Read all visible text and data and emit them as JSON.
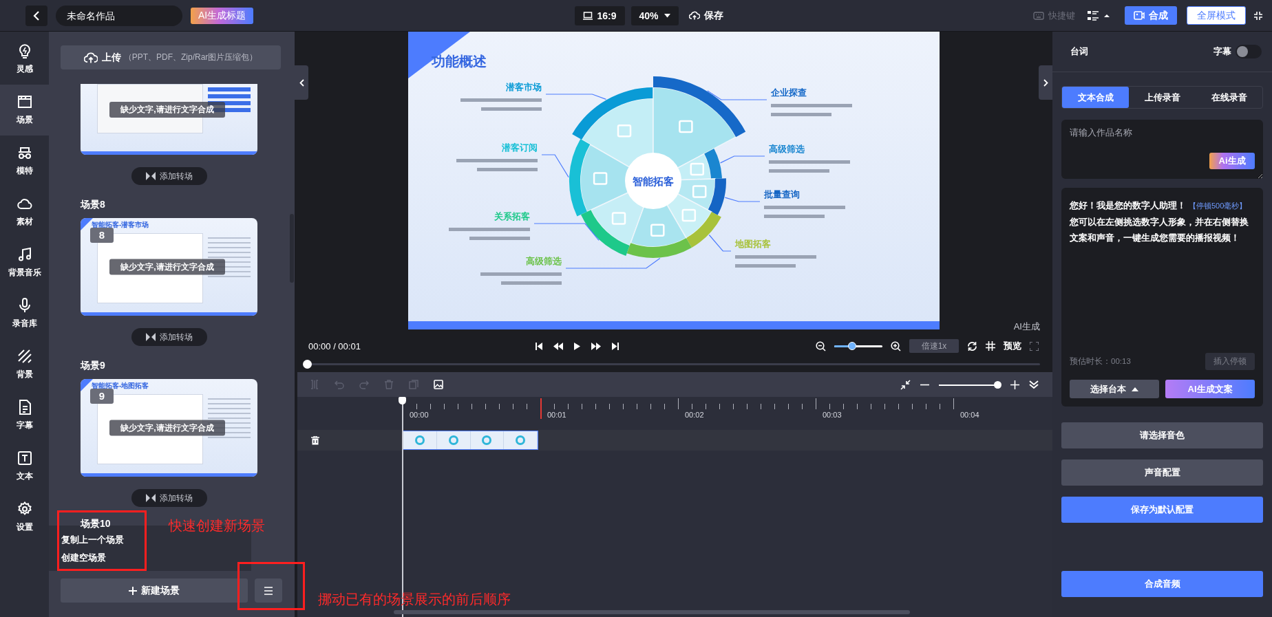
{
  "header": {
    "title": "未命名作品",
    "ai_title_button": "AI生成标题",
    "ratio": "16:9",
    "zoom": "40%",
    "save": "保存",
    "shortcuts": "快捷键",
    "compose": "合成",
    "fullscreen": "全屏模式"
  },
  "nav": [
    {
      "kind": "bulb",
      "label": "灵感",
      "selected": false
    },
    {
      "kind": "scene",
      "label": "场景",
      "selected": true
    },
    {
      "kind": "model",
      "label": "模特",
      "selected": false
    },
    {
      "kind": "cloud",
      "label": "素材",
      "selected": false
    },
    {
      "kind": "music",
      "label": "背景音乐",
      "selected": false
    },
    {
      "kind": "mic",
      "label": "录音库",
      "selected": false
    },
    {
      "kind": "stripes",
      "label": "背景",
      "selected": false
    },
    {
      "kind": "doc",
      "label": "字幕",
      "selected": false
    },
    {
      "kind": "text",
      "label": "文本",
      "selected": false
    },
    {
      "kind": "gear",
      "label": "设置",
      "selected": false
    }
  ],
  "scene_panel": {
    "upload": {
      "label": "上传",
      "hint": "（PPT、PDF、Zip/Rar图片压缩包）"
    },
    "scenes": [
      {
        "kind": "partial",
        "overlay": "缺少文字,请进行文字合成",
        "transition": "添加转场"
      },
      {
        "kind": "full",
        "label": "场景8",
        "number": "8",
        "thumb_title": "智能拓客-潜客市场",
        "overlay": "缺少文字,请进行文字合成",
        "transition": "添加转场"
      },
      {
        "kind": "full",
        "label": "场景9",
        "number": "9",
        "thumb_title": "智能拓客-地图拓客",
        "overlay": "缺少文字,请进行文字合成",
        "transition": "添加转场"
      }
    ],
    "last_scene_label": "场景10",
    "menu": [
      "复制上一个场景",
      "创建空场景"
    ],
    "new_scene": "新建场景"
  },
  "annotations": [
    {
      "text": "快速创建新场景"
    },
    {
      "text": "挪动已有的场景展示的前后顺序"
    }
  ],
  "stage": {
    "slide": {
      "title": "功能概述",
      "center": "智能拓客",
      "segments": [
        {
          "label": "潜客市场",
          "color": "#0a9bd6"
        },
        {
          "label": "企业探查",
          "color": "#1669c8"
        },
        {
          "label": "潜客订阅",
          "color": "#19c0d6"
        },
        {
          "label": "高级筛选",
          "color": "#1a86d0"
        },
        {
          "label": "批量查询",
          "color": "#1565c4"
        },
        {
          "label": "关系拓客",
          "color": "#1ec98a"
        },
        {
          "label": "地图拓客",
          "color": "#a8c23a"
        },
        {
          "label": "高级筛选",
          "color": "#6cc24a"
        }
      ]
    },
    "ai_label": "AI生成"
  },
  "player": {
    "time": "00:00 / 00:01",
    "zoom_slider": {
      "level": 0.37
    },
    "speed": "倍速1x",
    "preview": "预览",
    "progress": {
      "level": 0
    }
  },
  "timeline": {
    "zoom_slider": {
      "level": 0.95
    },
    "ruler": [
      "00:00",
      "00:01",
      "00:02",
      "00:03",
      "00:04"
    ]
  },
  "right_panel": {
    "title": "台词",
    "subtitle_toggle": {
      "label": "字幕",
      "on": false
    },
    "tabs": [
      {
        "label": "文本合成",
        "selected": true
      },
      {
        "label": "上传录音",
        "selected": false
      },
      {
        "label": "在线录音",
        "selected": false
      }
    ],
    "name_placeholder": "请输入作品名称",
    "ai_button": "Ai生成",
    "script": {
      "before": "您好！我是您的数字人助理！",
      "pause_tag": "【停顿500毫秒】",
      "after": "您可以在左侧挑选数字人形象，并在右侧替换文案和声音，一键生成您需要的播报视频！"
    },
    "estimate": "预估时长：00:13",
    "insert_pause": "插入停顿",
    "choose_script": "选择台本",
    "ai_copy": "AI生成文案",
    "buttons": [
      {
        "label": "请选择音色",
        "kind": "gray"
      },
      {
        "label": "声音配置",
        "kind": "gray"
      },
      {
        "label": "保存为默认配置",
        "kind": "primary"
      }
    ],
    "compose_audio": "合成音频"
  }
}
